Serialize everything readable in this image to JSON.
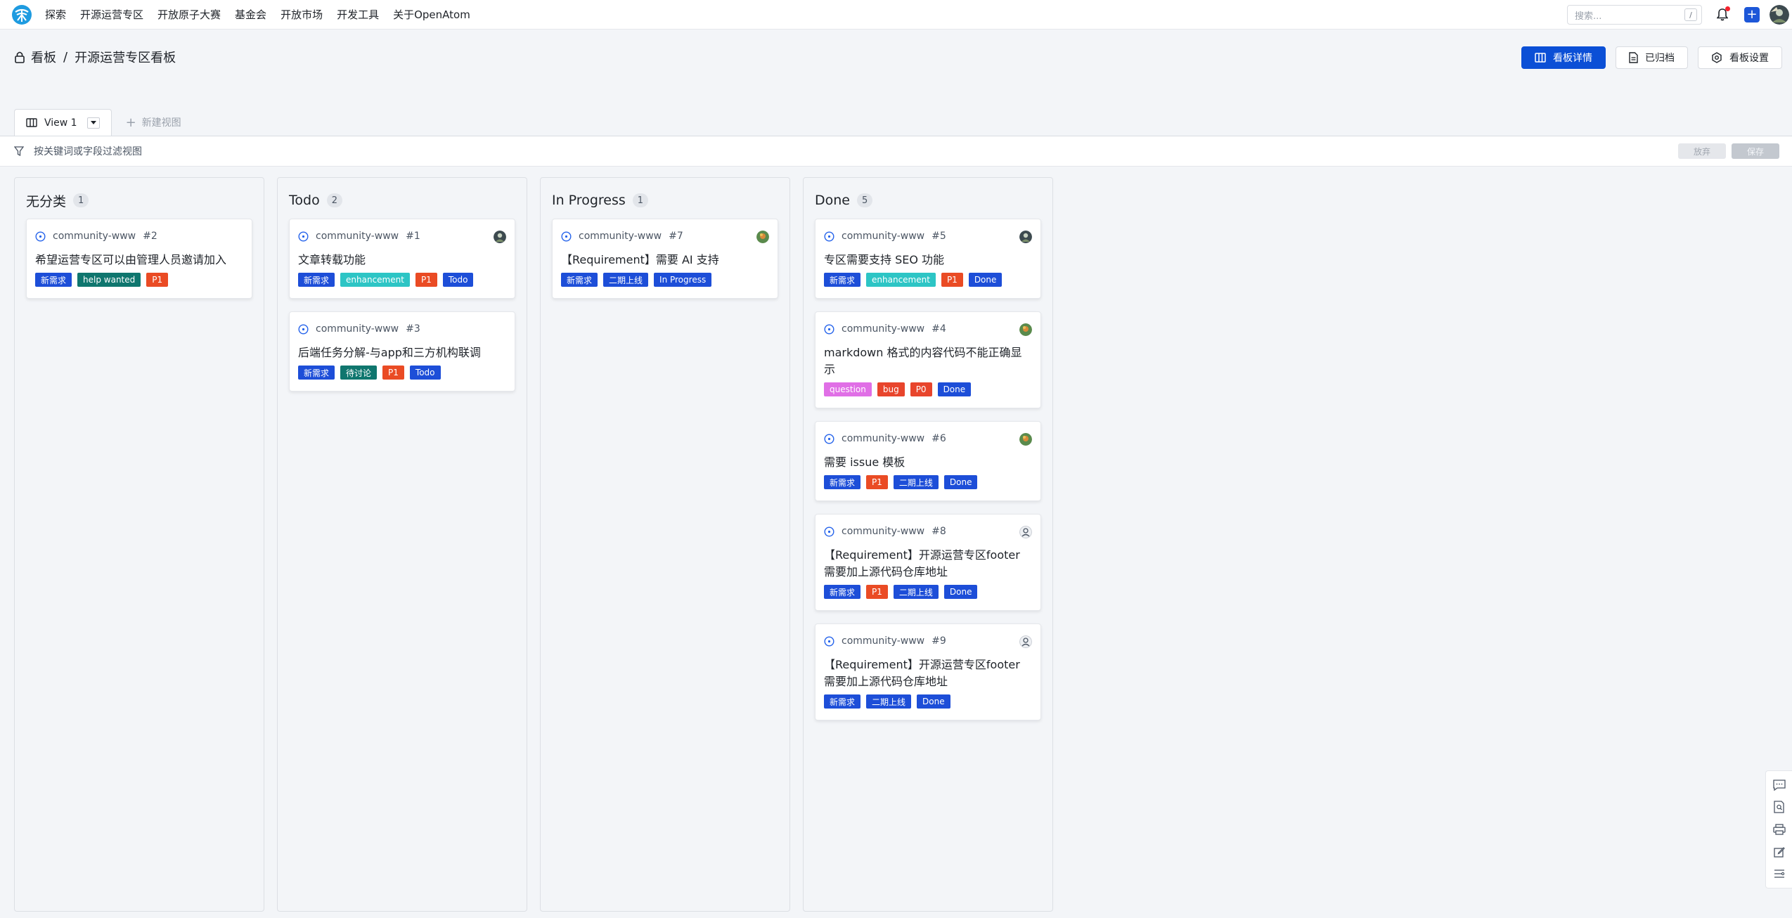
{
  "nav": {
    "items": [
      "探索",
      "开源运营专区",
      "开放原子大赛",
      "基金会",
      "开放市场",
      "开发工具",
      "关于OpenAtom"
    ],
    "search_placeholder": "搜索...",
    "search_shortcut": "/",
    "plus_label": "+"
  },
  "breadcrumb": {
    "root": "看板",
    "separator": "/",
    "current": "开源运营专区看板"
  },
  "header_actions": {
    "details": "看板详情",
    "archived": "已归档",
    "settings": "看板设置"
  },
  "views": {
    "tabs": [
      {
        "label": "View 1"
      }
    ],
    "new_view": "新建视图"
  },
  "filter": {
    "placeholder": "按关键词或字段过滤视图",
    "abandon": "放弃",
    "save": "保存"
  },
  "colors": {
    "primary": "#0b4fd6",
    "tag_new": "#1d4ed8",
    "tag_help": "#0f766e",
    "tag_p1": "#ea4b24",
    "tag_enhancement": "#2dc5c5",
    "tag_todo": "#1d4ed8",
    "tag_discuss": "#0f766e",
    "tag_question": "#e06fe6",
    "tag_bug": "#e8452c",
    "tag_p0": "#e8452c",
    "tag_phase2": "#1d4ed8",
    "tag_inprogress": "#1d4ed8",
    "tag_done": "#1d4ed8",
    "issue_icon": "#2563eb"
  },
  "columns": [
    {
      "title": "无分类",
      "count": "1",
      "cards": [
        {
          "repo": "community-www",
          "num": "#2",
          "title": "希望运营专区可以由管理人员邀请加入",
          "avatar": "none",
          "tags": [
            {
              "label": "新需求",
              "color": "#1d4ed8"
            },
            {
              "label": "help wanted",
              "color": "#0f766e"
            },
            {
              "label": "P1",
              "color": "#ea4b24"
            }
          ]
        }
      ]
    },
    {
      "title": "Todo",
      "count": "2",
      "cards": [
        {
          "repo": "community-www",
          "num": "#1",
          "title": "文章转载功能",
          "avatar": "avatar-a",
          "tags": [
            {
              "label": "新需求",
              "color": "#1d4ed8"
            },
            {
              "label": "enhancement",
              "color": "#2dc5c5"
            },
            {
              "label": "P1",
              "color": "#ea4b24"
            },
            {
              "label": "Todo",
              "color": "#1d4ed8"
            }
          ]
        },
        {
          "repo": "community-www",
          "num": "#3",
          "title": "后端任务分解-与app和三方机构联调",
          "avatar": "none",
          "tags": [
            {
              "label": "新需求",
              "color": "#1d4ed8"
            },
            {
              "label": "待讨论",
              "color": "#0f766e"
            },
            {
              "label": "P1",
              "color": "#ea4b24"
            },
            {
              "label": "Todo",
              "color": "#1d4ed8"
            }
          ]
        }
      ]
    },
    {
      "title": "In Progress",
      "count": "1",
      "cards": [
        {
          "repo": "community-www",
          "num": "#7",
          "title": "【Requirement】需要 AI 支持",
          "avatar": "avatar-b",
          "tags": [
            {
              "label": "新需求",
              "color": "#1d4ed8"
            },
            {
              "label": "二期上线",
              "color": "#1d4ed8"
            },
            {
              "label": "In Progress",
              "color": "#1d4ed8"
            }
          ]
        }
      ]
    },
    {
      "title": "Done",
      "count": "5",
      "cards": [
        {
          "repo": "community-www",
          "num": "#5",
          "title": "专区需要支持 SEO 功能",
          "avatar": "avatar-a",
          "tags": [
            {
              "label": "新需求",
              "color": "#1d4ed8"
            },
            {
              "label": "enhancement",
              "color": "#2dc5c5"
            },
            {
              "label": "P1",
              "color": "#ea4b24"
            },
            {
              "label": "Done",
              "color": "#1d4ed8"
            }
          ]
        },
        {
          "repo": "community-www",
          "num": "#4",
          "title": "markdown 格式的内容代码不能正确显示",
          "avatar": "avatar-b",
          "tags": [
            {
              "label": "question",
              "color": "#e06fe6"
            },
            {
              "label": "bug",
              "color": "#e8452c"
            },
            {
              "label": "P0",
              "color": "#e8452c"
            },
            {
              "label": "Done",
              "color": "#1d4ed8"
            }
          ]
        },
        {
          "repo": "community-www",
          "num": "#6",
          "title": "需要 issue 模板",
          "avatar": "avatar-b",
          "tags": [
            {
              "label": "新需求",
              "color": "#1d4ed8"
            },
            {
              "label": "P1",
              "color": "#ea4b24"
            },
            {
              "label": "二期上线",
              "color": "#1d4ed8"
            },
            {
              "label": "Done",
              "color": "#1d4ed8"
            }
          ]
        },
        {
          "repo": "community-www",
          "num": "#8",
          "title": "【Requirement】开源运营专区footer需要加上源代码仓库地址",
          "avatar": "avatar-default",
          "tags": [
            {
              "label": "新需求",
              "color": "#1d4ed8"
            },
            {
              "label": "P1",
              "color": "#ea4b24"
            },
            {
              "label": "二期上线",
              "color": "#1d4ed8"
            },
            {
              "label": "Done",
              "color": "#1d4ed8"
            }
          ]
        },
        {
          "repo": "community-www",
          "num": "#9",
          "title": "【Requirement】开源运营专区footer需要加上源代码仓库地址",
          "avatar": "avatar-default",
          "tags": [
            {
              "label": "新需求",
              "color": "#1d4ed8"
            },
            {
              "label": "二期上线",
              "color": "#1d4ed8"
            },
            {
              "label": "Done",
              "color": "#1d4ed8"
            }
          ]
        }
      ]
    }
  ],
  "side_tools": [
    "comment-icon",
    "doc-search-icon",
    "print-icon",
    "edit-icon",
    "list-settings-icon"
  ]
}
